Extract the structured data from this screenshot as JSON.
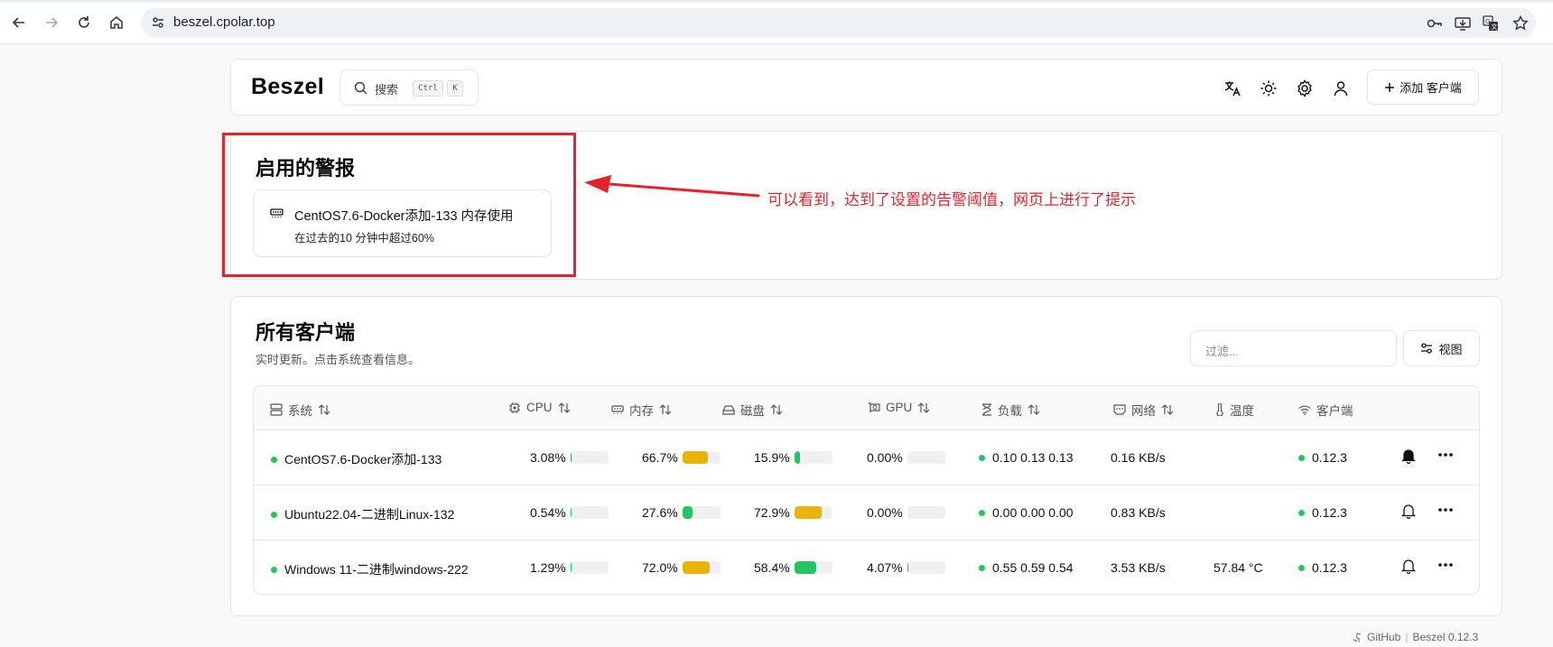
{
  "browser": {
    "url": "beszel.cpolar.top",
    "icons": [
      "back-arrow-icon",
      "forward-arrow-icon",
      "reload-icon",
      "home-icon",
      "site-settings-icon",
      "password-key-icon",
      "install-app-icon",
      "translate-icon",
      "bookmark-star-icon"
    ]
  },
  "header": {
    "logo": "Beszel",
    "search_label": "搜索",
    "search_kbd1": "Ctrl",
    "search_kbd2": "K",
    "add_button": "添加 客户端"
  },
  "alerts": {
    "title": "启用的警报",
    "items": [
      {
        "line1": "CentOS7.6-Docker添加-133 内存使用",
        "line2": "在过去的10 分钟中超过60%"
      }
    ]
  },
  "annotation": "可以看到，达到了设置的告警阈值，网页上进行了提示",
  "systems": {
    "title": "所有客户端",
    "subtitle": "实时更新。点击系统查看信息。",
    "filter_placeholder": "过滤...",
    "view_button": "视图",
    "columns": {
      "system": "系统",
      "cpu": "CPU",
      "memory": "内存",
      "disk": "磁盘",
      "gpu": "GPU",
      "load": "负载",
      "net": "网络",
      "temp": "温度",
      "agent": "客户端"
    },
    "rows": [
      {
        "name": "CentOS7.6-Docker添加-133",
        "cpu": "3.08%",
        "cpu_frac": 0.0308,
        "mem": "66.7%",
        "mem_frac": 0.667,
        "mem_color": "#eab308",
        "disk": "15.9%",
        "disk_frac": 0.159,
        "disk_color": "#22c55e",
        "gpu": "0.00%",
        "gpu_frac": 0,
        "load": "0.10 0.13 0.13",
        "net": "0.16 KB/s",
        "temp": "",
        "agent": "0.12.3",
        "bell_active": true
      },
      {
        "name": "Ubuntu22.04-二进制Linux-132",
        "cpu": "0.54%",
        "cpu_frac": 0.0054,
        "mem": "27.6%",
        "mem_frac": 0.276,
        "mem_color": "#22c55e",
        "disk": "72.9%",
        "disk_frac": 0.729,
        "disk_color": "#eab308",
        "gpu": "0.00%",
        "gpu_frac": 0,
        "load": "0.00 0.00 0.00",
        "net": "0.83 KB/s",
        "temp": "",
        "agent": "0.12.3",
        "bell_active": false
      },
      {
        "name": "Windows 11-二进制windows-222",
        "cpu": "1.29%",
        "cpu_frac": 0.0129,
        "mem": "72.0%",
        "mem_frac": 0.72,
        "mem_color": "#eab308",
        "disk": "58.4%",
        "disk_frac": 0.584,
        "disk_color": "#22c55e",
        "gpu": "4.07%",
        "gpu_frac": 0.0407,
        "load": "0.55 0.59 0.54",
        "net": "3.53 KB/s",
        "temp": "57.84 °C",
        "agent": "0.12.3",
        "bell_active": false
      }
    ]
  },
  "footer": {
    "github": "GitHub",
    "sep": "|",
    "version": "Beszel 0.12.3"
  },
  "colors": {
    "accent_red": "#e3242b",
    "ok_green": "#22c55e",
    "warn_yellow": "#eab308"
  }
}
